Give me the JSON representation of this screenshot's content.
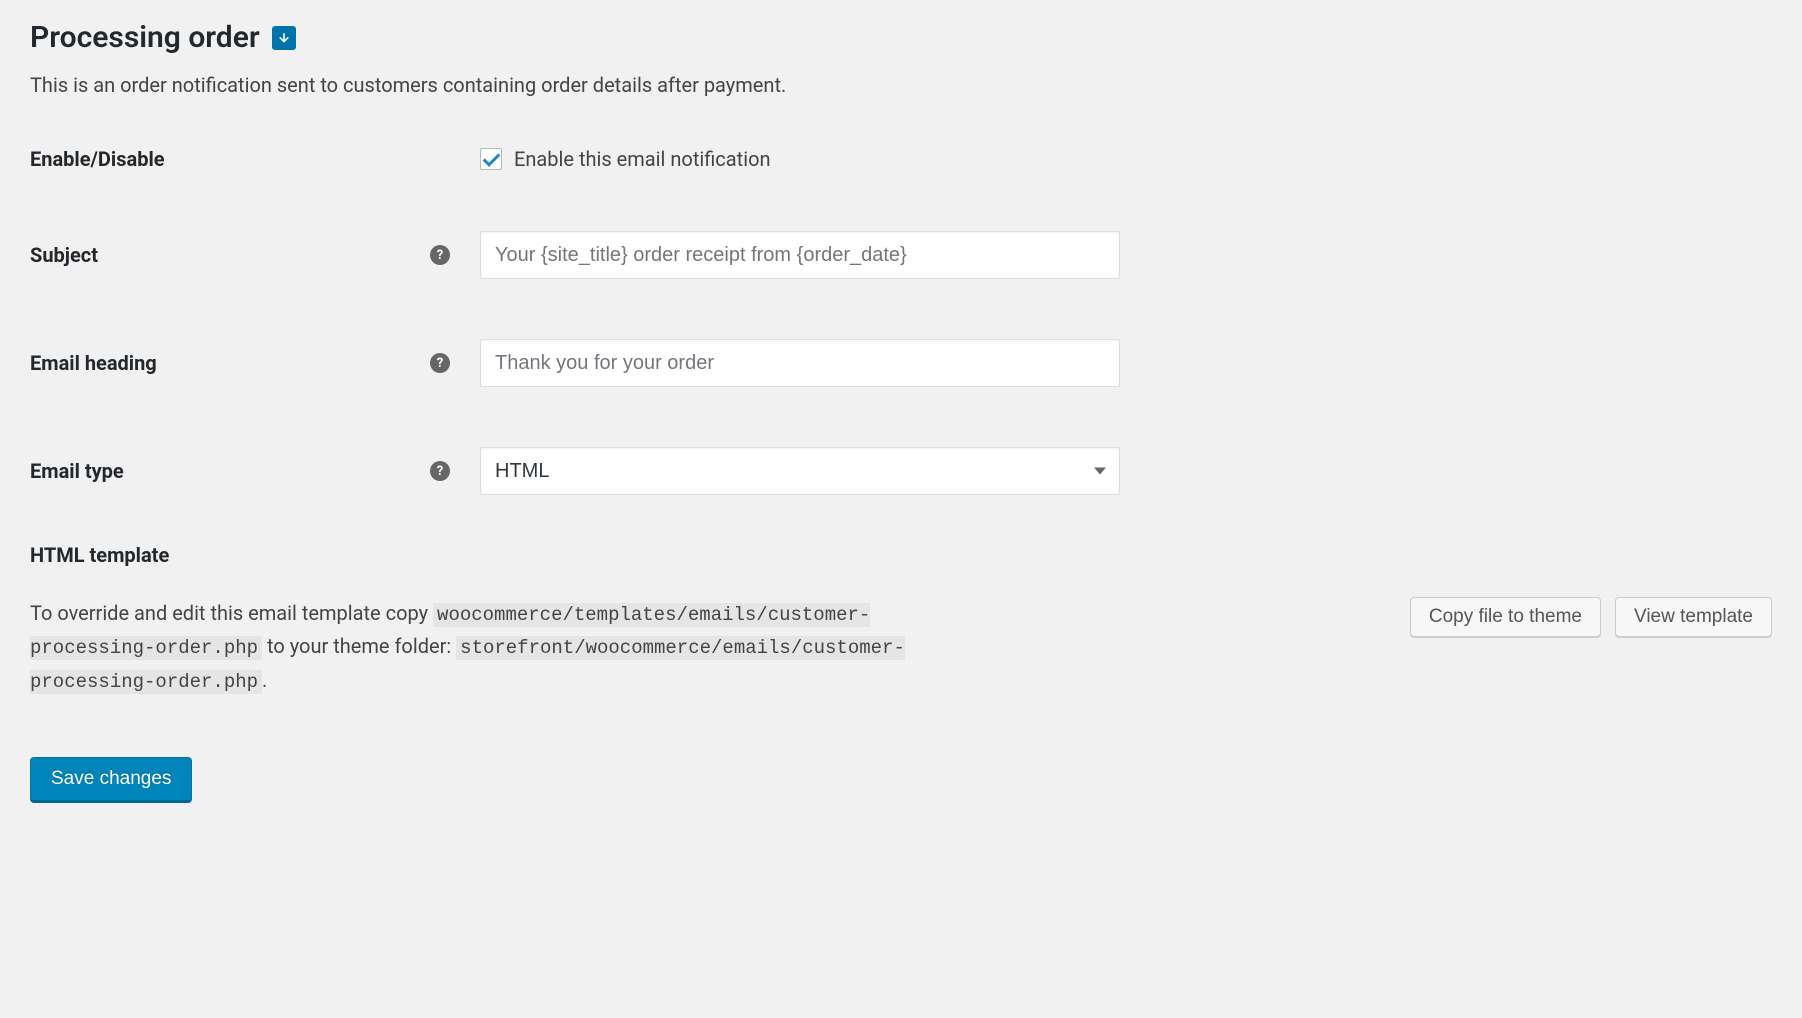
{
  "title": "Processing order",
  "description": "This is an order notification sent to customers containing order details after payment.",
  "fields": {
    "enable": {
      "label": "Enable/Disable",
      "checkbox_label": "Enable this email notification",
      "checked": true
    },
    "subject": {
      "label": "Subject",
      "placeholder": "Your {site_title} order receipt from {order_date}",
      "value": ""
    },
    "heading": {
      "label": "Email heading",
      "placeholder": "Thank you for your order",
      "value": ""
    },
    "type": {
      "label": "Email type",
      "value": "HTML"
    }
  },
  "template": {
    "section_label": "HTML template",
    "text_prefix": "To override and edit this email template copy ",
    "source_path": "woocommerce/templates/emails/customer-processing-order.php",
    "text_middle": " to your theme folder: ",
    "dest_path": "storefront/woocommerce/emails/customer-processing-order.php",
    "text_suffix": ".",
    "copy_button": "Copy file to theme",
    "view_button": "View template"
  },
  "save_button": "Save changes"
}
